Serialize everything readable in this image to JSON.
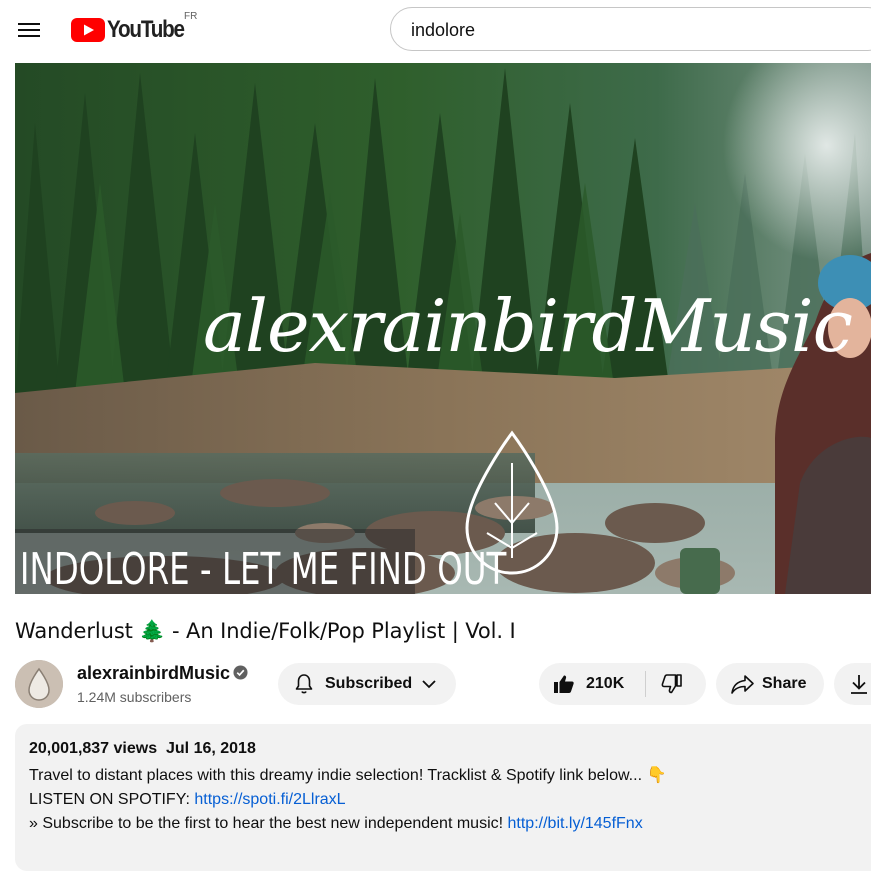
{
  "header": {
    "menu_icon": "hamburger-menu-icon",
    "logo_text": "YouTube",
    "logo_country": "FR",
    "search_value": "indolore"
  },
  "video": {
    "thumbnail_brand_text": "alexrainbirdMusic",
    "thumbnail_caption": "INDOLORE - LET ME FIND OUT"
  },
  "title": "Wanderlust 🌲 - An Indie/Folk/Pop Playlist | Vol. I",
  "owner": {
    "channel_name": "alexrainbirdMusic",
    "subscribers": "1.24M subscribers",
    "subscribe_label": "Subscribed"
  },
  "actions": {
    "like_count": "210K",
    "share_label": "Share"
  },
  "description": {
    "views": "20,001,837 views",
    "date": "Jul 16, 2018",
    "line1": "Travel to distant places with this dreamy indie selection! Tracklist & Spotify link below... 👇",
    "line2_prefix": "LISTEN ON SPOTIFY: ",
    "line2_link": "https://spoti.fi/2LlraxL",
    "line3_prefix": "» Subscribe to be the first to hear the best new independent music! ",
    "line3_link": "http://bit.ly/145fFnx"
  },
  "colors": {
    "youtube_red": "#ff0000",
    "link_blue": "#065fd4",
    "pill_bg": "#f2f2f2"
  }
}
